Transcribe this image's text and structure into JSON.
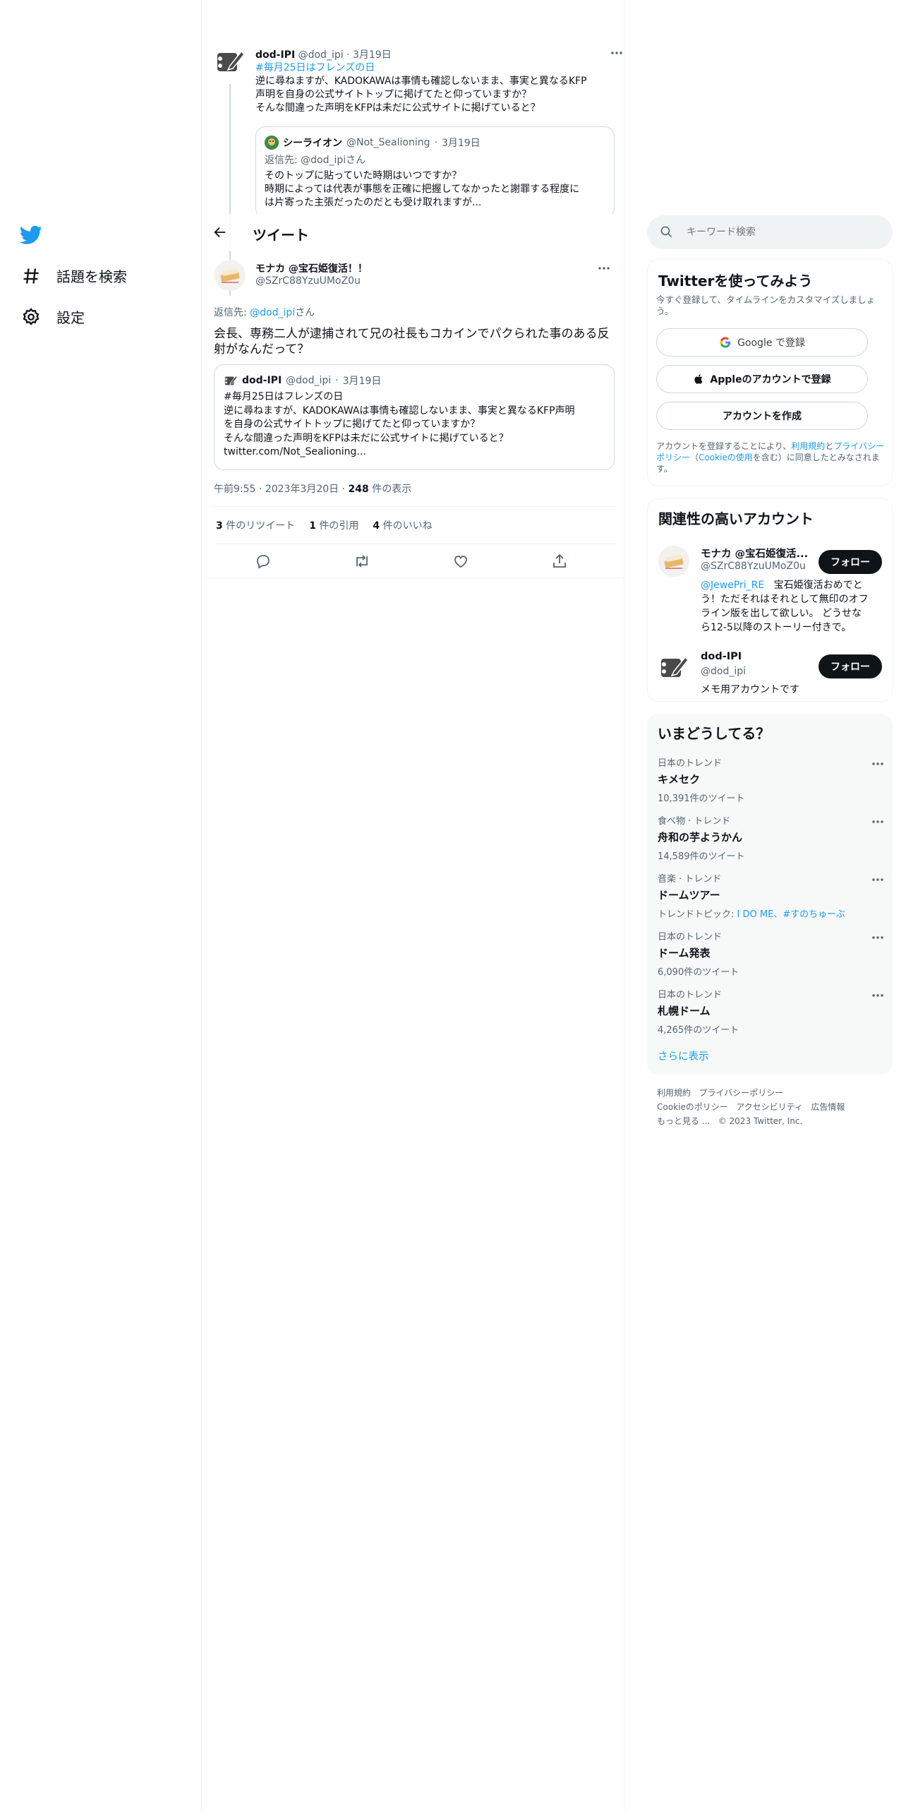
{
  "nav": {
    "explore_label": "話題を検索",
    "settings_label": "設定"
  },
  "header": {
    "title": "ツイート"
  },
  "parent_tweet": {
    "author": "dod-IPI",
    "handle": "@dod_ipi",
    "date": "3月19日",
    "hashtag": "#毎月25日はフレンズの日",
    "lines": [
      "逆に尋ねますが、KADOKAWAは事情も確認しないまま、事実と異なるKFP",
      "声明を自身の公式サイトトップに掲げてたと仰っていますか？",
      "そんな間違った声明をKFPは未だに公式サイトに掲げていると？"
    ],
    "quote": {
      "author": "シーライオン",
      "handle": "@Not_Sealioning",
      "date": "3月19日",
      "reply_prefix": "返信先: ",
      "reply_to": "@dod_ipiさん",
      "lines": [
        "そのトップに貼っていた時期はいつですか？",
        "時期によっては代表が事態を正確に把握してなかったと謝罪する程度に",
        "は片寄った主張だったのだとも受け取れますが..."
      ]
    }
  },
  "main_tweet": {
    "author": "モナカ @宝石姫復活！！",
    "handle": "@SZrC88YzuUMoZ0u",
    "reply_prefix": "返信先: ",
    "reply_handle": "@dod_ipi",
    "reply_suffix": "さん",
    "text_lines": [
      "会長、専務二人が逮捕されて兄の社長もコカインでパクられた事のある反",
      "射がなんだって？"
    ],
    "quote": {
      "author": "dod-IPI",
      "handle": "@dod_ipi",
      "date": "3月19日",
      "lines": [
        "#毎月25日はフレンズの日",
        "逆に尋ねますが、KADOKAWAは事情も確認しないまま、事実と異なるKFP声明",
        "を自身の公式サイトトップに掲げてたと仰っていますか？",
        "そんな間違った声明をKFPは未だに公式サイトに掲げていると？",
        "twitter.com/Not_Sealioning..."
      ]
    },
    "time": "午前9:55",
    "date": "2023年3月20日",
    "views": "248",
    "views_label": "件の表示",
    "stats": {
      "retweets": "3",
      "retweets_label": "件のリツイート",
      "quotes": "1",
      "quotes_label": "件の引用",
      "likes": "4",
      "likes_label": "件のいいね"
    }
  },
  "search": {
    "placeholder": "キーワード検索"
  },
  "signup": {
    "title": "Twitterを使ってみよう",
    "subtitle": "今すぐ登録して、タイムラインをカスタマイズしましょう。",
    "google_label": "Google で登録",
    "apple_label": "Appleのアカウントで登録",
    "create_label": "アカウントを作成",
    "legal_pre": "アカウントを登録することにより、",
    "terms": "利用規約",
    "and": "と",
    "privacy": "プライバシーポリシー",
    "paren_open": "（",
    "cookie": "Cookieの使用",
    "legal_post": "を含む）に同意したとみなされます。"
  },
  "related": {
    "title": "関連性の高いアカウント",
    "follow_label": "フォロー",
    "accounts": [
      {
        "name": "モナカ @宝石姫復活...",
        "handle": "@SZrC88YzuUMoZ0u",
        "bio_mention": "@JewePri_RE",
        "bio_lines": [
          "宝石姫復活おめでと",
          "う！ただそれはそれとして無印のオフ",
          "ライン版を出して欲しい。 どうせな",
          "ら12-5以降のストーリー付きで。"
        ]
      },
      {
        "name": "dod-IPI",
        "handle": "@dod_ipi",
        "bio": "メモ用アカウントです"
      }
    ]
  },
  "trends": {
    "title": "いまどうしてる？",
    "items": [
      {
        "category": "日本のトレンド",
        "name": "キメセク",
        "count": "10,391件のツイート"
      },
      {
        "category": "食べ物 · トレンド",
        "name": "舟和の芋ようかん",
        "count": "14,589件のツイート"
      },
      {
        "category": "音楽 · トレンド",
        "name": "ドームツアー",
        "topic_label": "トレンドトピック: ",
        "topics": "I DO ME、#すのちゅーぶ"
      },
      {
        "category": "日本のトレンド",
        "name": "ドーム発表",
        "count": "6,090件のツイート"
      },
      {
        "category": "日本のトレンド",
        "name": "札幌ドーム",
        "count": "4,265件のツイート"
      }
    ],
    "show_more": "さらに表示"
  },
  "footer": {
    "links": [
      "利用規約",
      "プライバシーポリシー",
      "Cookieのポリシー",
      "アクセシビリティ",
      "広告情報",
      "もっと見る ..."
    ],
    "copyright": "© 2023 Twitter, Inc."
  },
  "colors": {
    "accent": "#1d9bf0",
    "text": "#0f1419",
    "secondary": "#536471",
    "border": "#eff3f4"
  }
}
